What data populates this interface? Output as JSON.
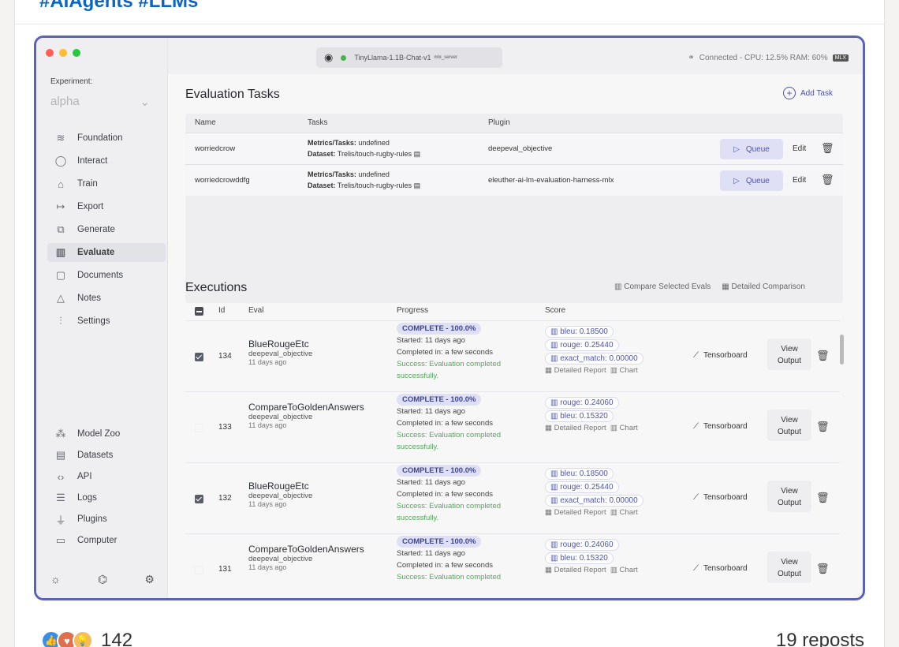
{
  "post": {
    "hashtags": "#AIAgents #LLMs",
    "reaction_count": "142",
    "reposts": "19 reposts"
  },
  "topbar": {
    "model": "TinyLlama-1.1B-Chat-v1",
    "model_tag": "mlx_server",
    "connection": "Connected - CPU: 12.5% RAM: 60%",
    "engine_badge": "MLX"
  },
  "sidebar": {
    "experiment_label": "Experiment:",
    "experiment_value": "alpha",
    "items": [
      {
        "label": "Foundation",
        "icon": "layers-icon"
      },
      {
        "label": "Interact",
        "icon": "chat-icon"
      },
      {
        "label": "Train",
        "icon": "graduation-cap-icon"
      },
      {
        "label": "Export",
        "icon": "export-arrow-icon"
      },
      {
        "label": "Generate",
        "icon": "shapes-icon"
      },
      {
        "label": "Evaluate",
        "icon": "bar-chart-icon"
      },
      {
        "label": "Documents",
        "icon": "document-icon"
      },
      {
        "label": "Notes",
        "icon": "flask-icon"
      },
      {
        "label": "Settings",
        "icon": "sliders-icon"
      }
    ],
    "bottom_items": [
      {
        "label": "Model Zoo",
        "icon": "models-icon"
      },
      {
        "label": "Datasets",
        "icon": "dataset-icon"
      },
      {
        "label": "API",
        "icon": "code-icon"
      },
      {
        "label": "Logs",
        "icon": "lines-icon"
      },
      {
        "label": "Plugins",
        "icon": "plug-icon"
      },
      {
        "label": "Computer",
        "icon": "monitor-icon"
      }
    ]
  },
  "tasks": {
    "title": "Evaluation Tasks",
    "add_label": "Add Task",
    "columns": [
      "Name",
      "Tasks",
      "Plugin"
    ],
    "rows": [
      {
        "name": "worriedcrow",
        "metrics_label": "Metrics/Tasks:",
        "metrics": "undefined",
        "dataset_label": "Dataset:",
        "dataset": "Trelis/touch-rugby-rules",
        "plugin": "deepeval_objective",
        "queue": "Queue",
        "edit": "Edit"
      },
      {
        "name": "worriedcrowddfg",
        "metrics_label": "Metrics/Tasks:",
        "metrics": "undefined",
        "dataset_label": "Dataset:",
        "dataset": "Trelis/touch-rugby-rules",
        "plugin": "eleuther-ai-lm-evaluation-harness-mlx",
        "queue": "Queue",
        "edit": "Edit"
      }
    ]
  },
  "executions": {
    "title": "Executions",
    "compare_label": "Compare Selected Evals",
    "detailed_label": "Detailed Comparison",
    "columns": [
      "Id",
      "Eval",
      "Progress",
      "Score"
    ],
    "rows": [
      {
        "id": "134",
        "eval": "BlueRougeEtc",
        "plugin": "deepeval_objective",
        "age": "11 days ago",
        "status": "COMPLETE - 100.0%",
        "started": "Started: 11 days ago",
        "completed": "Completed in: a few seconds",
        "success1": "Success: Evaluation completed",
        "success2": "successfully.",
        "scores": [
          "bleu: 0.18500",
          "rouge: 0.25440",
          "exact_match: 0.00000"
        ],
        "detail": "Detailed Report",
        "chart": "Chart",
        "tensorboard": "Tensorboard",
        "view1": "View",
        "view2": "Output",
        "checked": true
      },
      {
        "id": "133",
        "eval": "CompareToGoldenAnswers",
        "plugin": "deepeval_objective",
        "age": "11 days ago",
        "status": "COMPLETE - 100.0%",
        "started": "Started: 11 days ago",
        "completed": "Completed in: a few seconds",
        "success1": "Success: Evaluation completed",
        "success2": "successfully.",
        "scores": [
          "rouge: 0.24060",
          "bleu: 0.15320"
        ],
        "detail": "Detailed Report",
        "chart": "Chart",
        "tensorboard": "Tensorboard",
        "view1": "View",
        "view2": "Output",
        "checked": false
      },
      {
        "id": "132",
        "eval": "BlueRougeEtc",
        "plugin": "deepeval_objective",
        "age": "11 days ago",
        "status": "COMPLETE - 100.0%",
        "started": "Started: 11 days ago",
        "completed": "Completed in: a few seconds",
        "success1": "Success: Evaluation completed",
        "success2": "successfully.",
        "scores": [
          "bleu: 0.18500",
          "rouge: 0.25440",
          "exact_match: 0.00000"
        ],
        "detail": "Detailed Report",
        "chart": "Chart",
        "tensorboard": "Tensorboard",
        "view1": "View",
        "view2": "Output",
        "checked": true
      },
      {
        "id": "131",
        "eval": "CompareToGoldenAnswers",
        "plugin": "deepeval_objective",
        "age": "11 days ago",
        "status": "COMPLETE - 100.0%",
        "started": "Started: 11 days ago",
        "completed": "Completed in: a few seconds",
        "success1": "Success: Evaluation completed",
        "success2": "",
        "scores": [
          "rouge: 0.24060",
          "bleu: 0.15320"
        ],
        "detail": "Detailed Report",
        "chart": "Chart",
        "tensorboard": "Tensorboard",
        "view1": "View",
        "view2": "Output",
        "checked": false
      }
    ]
  },
  "colors": {
    "accent": "#4d55a8",
    "frame": "#5b63b7",
    "success": "#5aa35e"
  }
}
